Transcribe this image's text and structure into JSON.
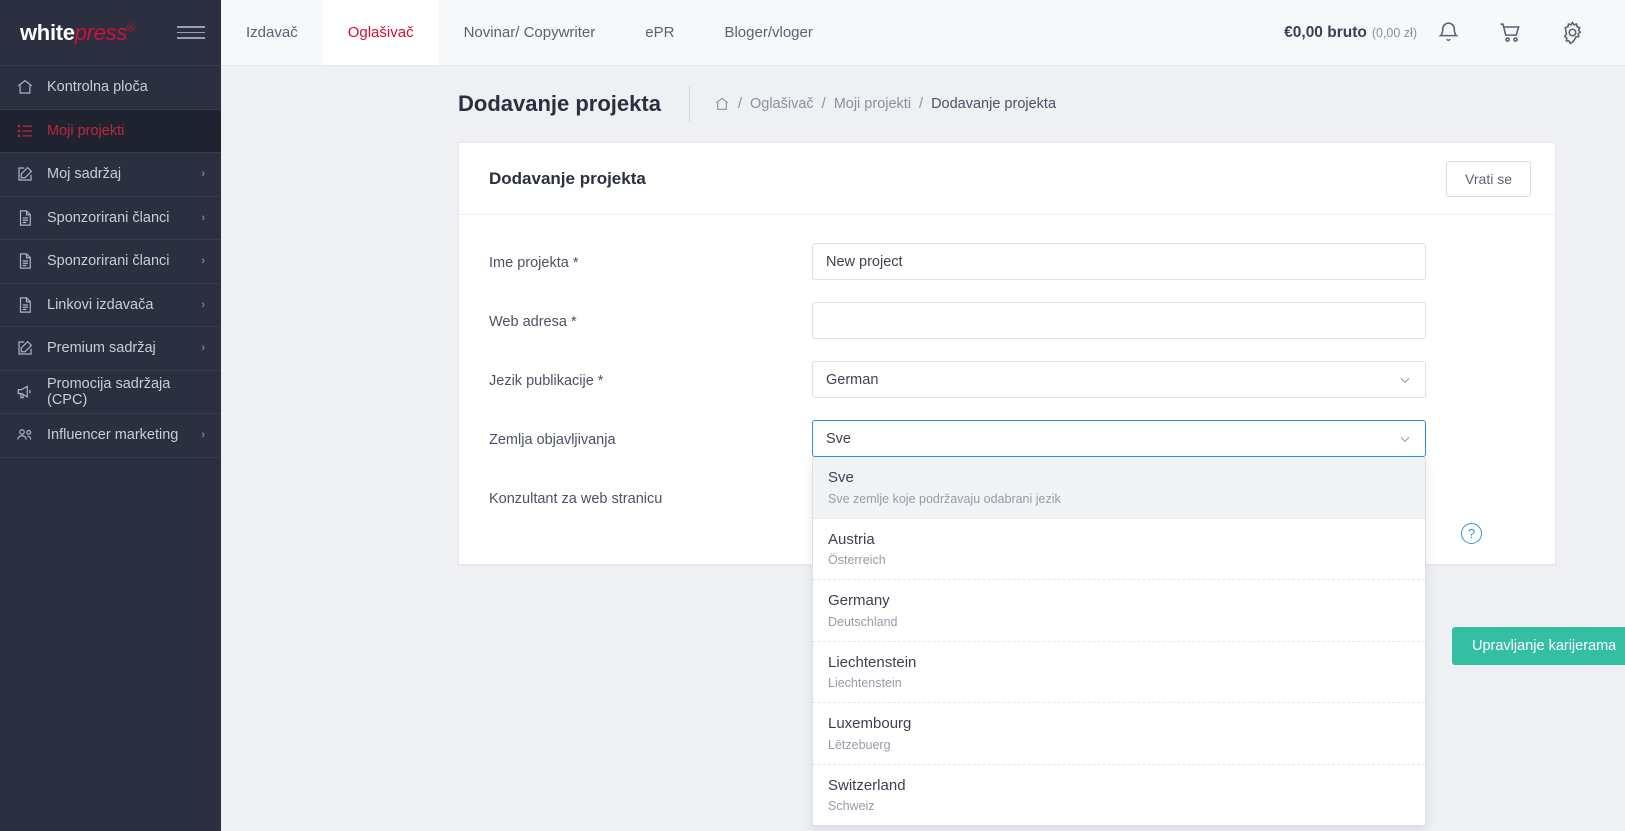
{
  "sidebar": {
    "logo": {
      "part1": "white",
      "part2": "press",
      "reg": "®"
    },
    "menu_icon": "hamburger-icon",
    "items": [
      {
        "label": "Kontrolna ploča",
        "icon": "home-icon",
        "arrow": "",
        "active": false
      },
      {
        "label": "Moji projekti",
        "icon": "list-icon",
        "arrow": "",
        "active": true
      },
      {
        "label": "Moj sadržaj",
        "icon": "edit-icon",
        "arrow": "›",
        "active": false
      },
      {
        "label": "Sponzorirani članci",
        "icon": "document-icon",
        "arrow": "›",
        "active": false
      },
      {
        "label": "Sponzorirani članci",
        "icon": "document-icon",
        "arrow": "›",
        "active": false
      },
      {
        "label": "Linkovi izdavača",
        "icon": "document-icon",
        "arrow": "›",
        "active": false
      },
      {
        "label": "Premium sadržaj",
        "icon": "edit-icon",
        "arrow": "›",
        "active": false
      },
      {
        "label": "Promocija sadržaja (CPC)",
        "icon": "megaphone-icon",
        "arrow": "",
        "active": false
      },
      {
        "label": "Influencer marketing",
        "icon": "users-icon",
        "arrow": "›",
        "active": false
      }
    ]
  },
  "topbar": {
    "tabs": [
      {
        "label": "Izdavač",
        "active": false
      },
      {
        "label": "Oglašivač",
        "active": true
      },
      {
        "label": "Novinar/ Copywriter",
        "active": false
      },
      {
        "label": "ePR",
        "active": false
      },
      {
        "label": "Bloger/vloger",
        "active": false
      }
    ],
    "balance": "€0,00 bruto",
    "balance_sub": "(0,00 zł)",
    "icons": [
      "bell-icon",
      "cart-icon",
      "gear-icon"
    ]
  },
  "breadcrumb": {
    "page_title": "Dodavanje projekta",
    "home_icon": "home-icon",
    "items": [
      "Oglašivač",
      "Moji projekti"
    ],
    "current": "Dodavanje projekta",
    "separator": "/"
  },
  "card": {
    "title": "Dodavanje projekta",
    "back_button": "Vrati se"
  },
  "form": {
    "fields": [
      {
        "label": "Ime projekta *",
        "value": "New project",
        "placeholder": ""
      },
      {
        "label": "Web adresa *",
        "value": "",
        "placeholder": ""
      }
    ],
    "language": {
      "label": "Jezik publikacije *",
      "value": "German"
    },
    "country": {
      "label": "Zemlja objavljivanja",
      "value": "Sve"
    },
    "consultant": {
      "label": "Konzultant za web stranicu"
    },
    "help_icon": "question-mark-icon",
    "help_glyph": "?",
    "green_button": "Upravljanje karijerama"
  },
  "dropdown": {
    "options": [
      {
        "name": "Sve",
        "native": "Sve zemlje koje podržavaju odabrani jezik",
        "highlighted": true
      },
      {
        "name": "Austria",
        "native": "Österreich",
        "highlighted": false
      },
      {
        "name": "Germany",
        "native": "Deutschland",
        "highlighted": false
      },
      {
        "name": "Liechtenstein",
        "native": "Liechtenstein",
        "highlighted": false
      },
      {
        "name": "Luxembourg",
        "native": "Lëtzebuerg",
        "highlighted": false
      },
      {
        "name": "Switzerland",
        "native": "Schweiz",
        "highlighted": false
      }
    ]
  },
  "colors": {
    "sidebar_bg": "#2b2f3f",
    "accent_red": "#d0103a",
    "active_red": "#c0263c",
    "green": "#34bfa3",
    "focus_blue": "#2f8fdf",
    "page_bg": "#eef0f4"
  }
}
